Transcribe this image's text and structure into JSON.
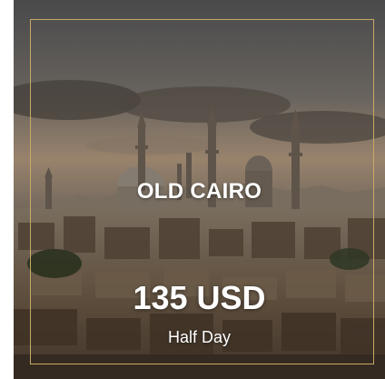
{
  "tour_card": {
    "title": "OLD CAIRO",
    "price": "135 USD",
    "duration": "Half Day",
    "image_icon": "cairo-skyline-photo",
    "colors": {
      "frame_border": "#c9a867",
      "text": "#ffffff"
    }
  }
}
